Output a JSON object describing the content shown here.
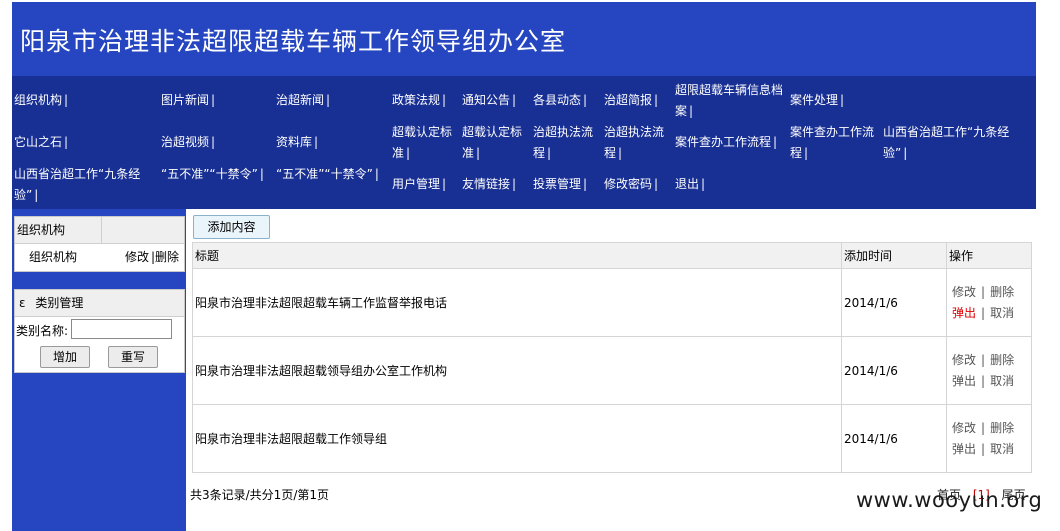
{
  "banner": {
    "title": "阳泉市治理非法超限超载车辆工作领导组办公室"
  },
  "nav": [
    {
      "label": "组织机构"
    },
    {
      "label": "图片新闻"
    },
    {
      "label": "治超新闻"
    },
    {
      "label": "政策法规"
    },
    {
      "label": "通知公告"
    },
    {
      "label": "各县动态"
    },
    {
      "label": "治超简报"
    },
    {
      "label": "超限超载车辆信息档案"
    },
    {
      "label": "案件处理"
    },
    {
      "label": "它山之石"
    },
    {
      "label": "治超视频"
    },
    {
      "label": "资料库"
    },
    {
      "label": "超载认定标准"
    },
    {
      "label": "超载认定标准"
    },
    {
      "label": "治超执法流程"
    },
    {
      "label": "治超执法流程"
    },
    {
      "label": "案件查办工作流程"
    },
    {
      "label": "案件查办工作流程"
    },
    {
      "label": "山西省治超工作“九条经验”"
    },
    {
      "label": "山西省治超工作“九条经验”"
    },
    {
      "label": "“五不准”“十禁令”"
    },
    {
      "label": "“五不准”“十禁令”"
    },
    {
      "label": "用户管理"
    },
    {
      "label": "友情链接"
    },
    {
      "label": "投票管理"
    },
    {
      "label": "修改密码"
    },
    {
      "label": "退出"
    }
  ],
  "sidebar": {
    "org": {
      "header": "组织机构",
      "item": "组织机构",
      "edit": "修改",
      "delete": "删除"
    },
    "category": {
      "icon": "ε",
      "header": "类别管理",
      "field_label": "类别名称:",
      "field_value": "",
      "add": "增加",
      "reset": "重写"
    }
  },
  "toolbar": {
    "add_label": "添加内容"
  },
  "table": {
    "headers": [
      "标题",
      "添加时间",
      "操作"
    ],
    "rows": [
      {
        "title": "阳泉市治理非法超限超载车辆工作监督举报电话",
        "date": "2014/1/6"
      },
      {
        "title": "阳泉市治理非法超限超载领导组办公室工作机构",
        "date": "2014/1/6"
      },
      {
        "title": "阳泉市治理非法超限超载工作领导组",
        "date": "2014/1/6"
      }
    ],
    "ops": {
      "edit": "修改",
      "delete": "删除",
      "popup": "弹出",
      "cancel": "取消"
    }
  },
  "pager": {
    "info": "共3条记录/共分1页/第1页",
    "first": "首页",
    "current": "[1]",
    "last": "尾页"
  },
  "watermark": "www.wooyun.org",
  "colors": {
    "banner": "#2546c0",
    "nav": "#182f93",
    "sidebar": "#2546c0",
    "highlight": "#e00000"
  }
}
